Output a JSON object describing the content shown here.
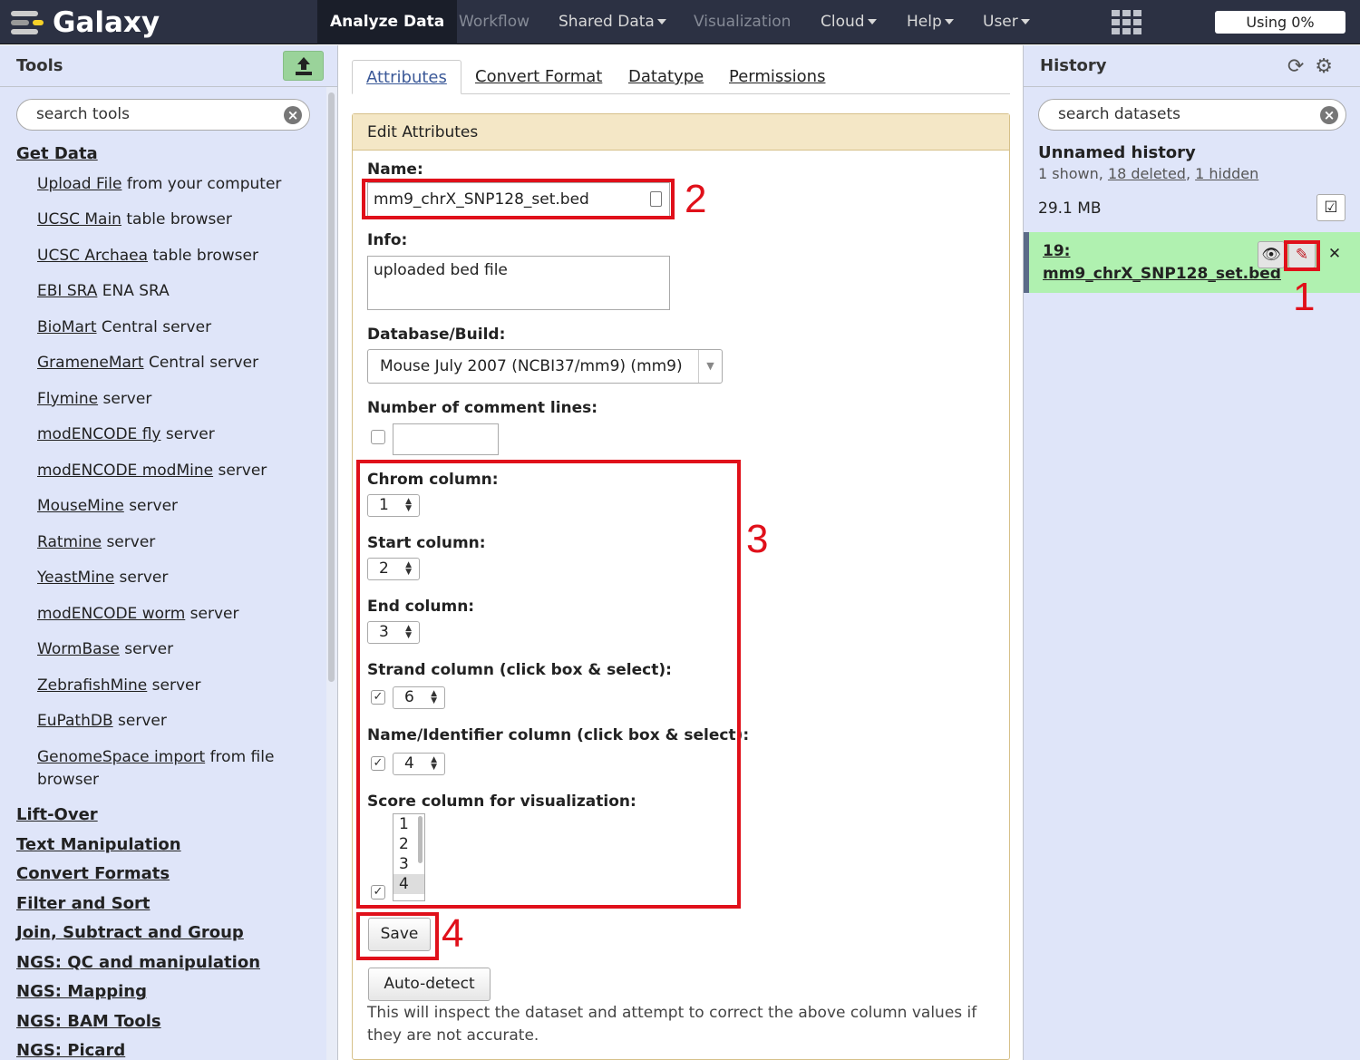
{
  "masthead": {
    "brand": "Galaxy",
    "nav": [
      {
        "label": "Analyze Data",
        "active": true
      },
      {
        "label": "Workflow",
        "dim": true
      },
      {
        "label": "Shared Data",
        "dropdown": true
      },
      {
        "label": "Visualization",
        "dim": true
      },
      {
        "label": "Cloud",
        "dropdown": true
      },
      {
        "label": "Help",
        "dropdown": true
      },
      {
        "label": "User",
        "dropdown": true
      }
    ],
    "quota": "Using 0%"
  },
  "tools": {
    "title": "Tools",
    "search_placeholder": "search tools",
    "get_data": "Get Data",
    "items": [
      {
        "link": "Upload File",
        "rest": " from your computer"
      },
      {
        "link": "UCSC Main",
        "rest": " table browser"
      },
      {
        "link": "UCSC Archaea",
        "rest": " table browser"
      },
      {
        "link": "EBI SRA",
        "rest": " ENA SRA"
      },
      {
        "link": "BioMart",
        "rest": " Central server"
      },
      {
        "link": "GrameneMart",
        "rest": " Central server"
      },
      {
        "link": "Flymine",
        "rest": " server"
      },
      {
        "link": "modENCODE fly",
        "rest": " server"
      },
      {
        "link": "modENCODE modMine",
        "rest": " server"
      },
      {
        "link": "MouseMine",
        "rest": " server"
      },
      {
        "link": "Ratmine",
        "rest": " server"
      },
      {
        "link": "YeastMine",
        "rest": " server"
      },
      {
        "link": "modENCODE worm",
        "rest": " server"
      },
      {
        "link": "WormBase",
        "rest": " server"
      },
      {
        "link": "ZebrafishMine",
        "rest": " server"
      },
      {
        "link": "EuPathDB",
        "rest": " server"
      },
      {
        "link": "GenomeSpace import",
        "rest": " from file browser"
      }
    ],
    "sections": [
      "Lift-Over",
      "Text Manipulation",
      "Convert Formats",
      "Filter and Sort",
      "Join, Subtract and Group",
      "NGS: QC and manipulation",
      "NGS: Mapping",
      "NGS: BAM Tools",
      "NGS: Picard"
    ]
  },
  "center": {
    "tabs": [
      "Attributes",
      "Convert Format",
      "Datatype",
      "Permissions"
    ],
    "form_title": "Edit Attributes",
    "name_label": "Name:",
    "name_value": "mm9_chrX_SNP128_set.bed",
    "info_label": "Info:",
    "info_value": "uploaded bed file",
    "db_label": "Database/Build:",
    "db_value": "Mouse July 2007 (NCBI37/mm9) (mm9)",
    "comment_label": "Number of comment lines:",
    "chrom_label": "Chrom column:",
    "chrom_value": "1",
    "start_label": "Start column:",
    "start_value": "2",
    "end_label": "End column:",
    "end_value": "3",
    "strand_label": "Strand column (click box & select):",
    "strand_value": "6",
    "nameid_label": "Name/Identifier column (click box & select):",
    "nameid_value": "4",
    "score_label": "Score column for visualization:",
    "score_options": [
      "1",
      "2",
      "3",
      "4"
    ],
    "save_label": "Save",
    "autodetect_label": "Auto-detect",
    "help_text": "This will inspect the dataset and attempt to correct the above column values if they are not accurate."
  },
  "history": {
    "title": "History",
    "search_placeholder": "search datasets",
    "name": "Unnamed history",
    "summary_prefix": "1 shown, ",
    "deleted": "18 deleted",
    "sep": ", ",
    "hidden": "1 hidden",
    "size": "29.1 MB",
    "dataset_title": "19: mm9_chrX_SNP128_set.bed"
  },
  "annotations": {
    "one": "1",
    "two": "2",
    "three": "3",
    "four": "4"
  },
  "colors": {
    "masthead": "#2c3143",
    "panel": "#dfe5f9",
    "dataset_ok": "#b0f1b0",
    "form_header": "#f4e7c6",
    "annotation_red": "#e0101a"
  }
}
